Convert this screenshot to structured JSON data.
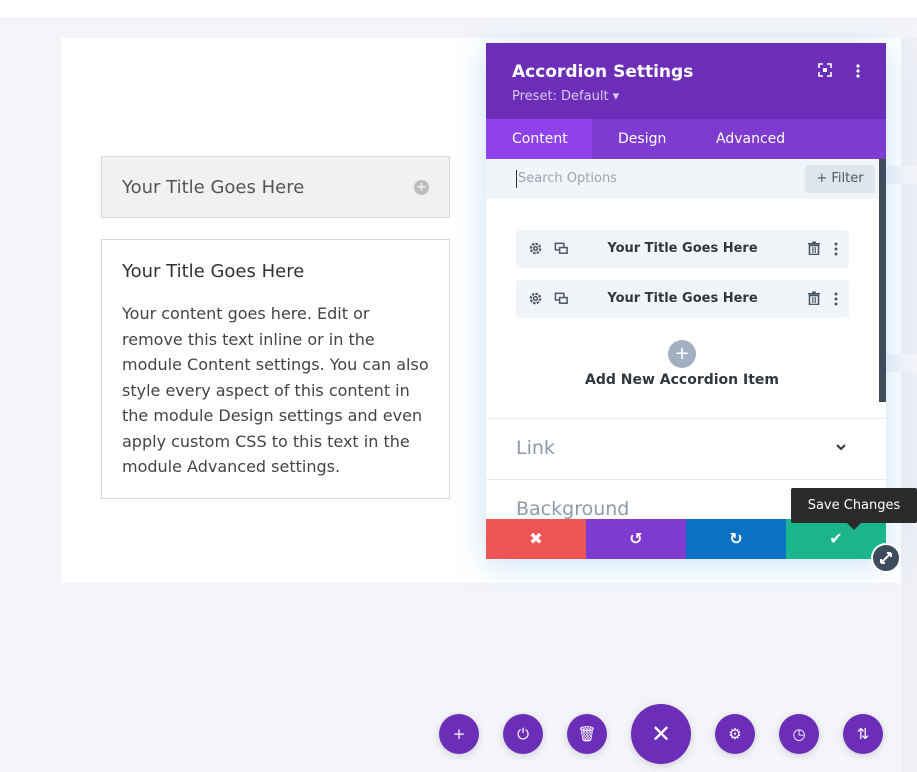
{
  "colors": {
    "header_purple": "#6c2eb9",
    "tab_purple": "#7e3bd0",
    "tab_active": "#8f42ec",
    "discard_red": "#ef5555",
    "undo_purple": "#7e3bd0",
    "redo_blue": "#0c71c3",
    "save_green": "#1ab58a"
  },
  "preview": {
    "closed_title": "Your Title Goes Here",
    "open_title": "Your Title Goes Here",
    "open_body": "Your content goes here. Edit or remove this text inline or in the module Content settings. You can also style every aspect of this content in the module Design settings and even apply custom CSS to this text in the module Advanced settings."
  },
  "modal": {
    "title": "Accordion Settings",
    "preset": "Preset: Default ▾",
    "tabs": [
      {
        "label": "Content",
        "active": true
      },
      {
        "label": "Design",
        "active": false
      },
      {
        "label": "Advanced",
        "active": false
      }
    ],
    "search_placeholder": "Search Options",
    "filter_label": "+ Filter",
    "items": [
      {
        "label": "Your Title Goes Here"
      },
      {
        "label": "Your Title Goes Here"
      }
    ],
    "add_icon": "+",
    "add_label": "Add New Accordion Item",
    "sections": [
      {
        "label": "Link"
      },
      {
        "label": "Background"
      }
    ]
  },
  "footer": {
    "discard_icon": "✖",
    "undo_icon": "↺",
    "redo_icon": "↻",
    "save_icon": "✔"
  },
  "tooltip": "Save Changes",
  "fabs": [
    {
      "name": "add",
      "icon": "+"
    },
    {
      "name": "power",
      "icon": "⏻"
    },
    {
      "name": "trash",
      "icon": "🗑"
    },
    {
      "name": "close",
      "icon": "✕"
    },
    {
      "name": "settings",
      "icon": "⚙"
    },
    {
      "name": "history",
      "icon": "◷"
    },
    {
      "name": "sort",
      "icon": "⇅"
    }
  ]
}
